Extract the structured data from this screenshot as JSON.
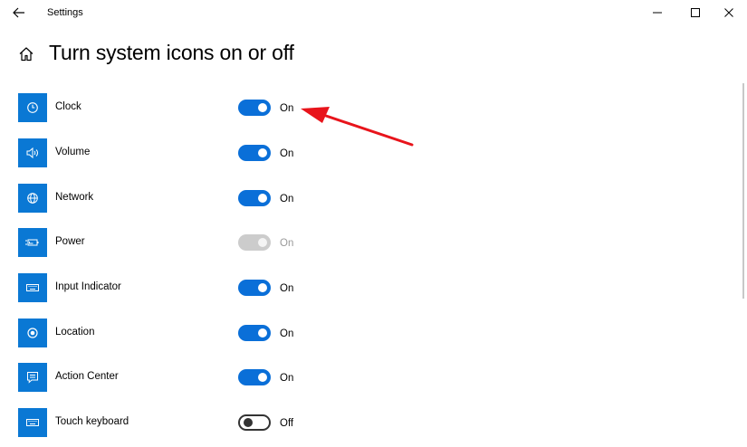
{
  "window": {
    "title": "Settings",
    "icons": {
      "back": "back-arrow-icon",
      "minimize": "minimize-icon",
      "maximize": "maximize-icon",
      "close": "close-icon"
    }
  },
  "page": {
    "title": "Turn system icons on or off",
    "home_icon": "home-icon"
  },
  "items": [
    {
      "label": "Clock",
      "icon": "clock-icon",
      "state": "On",
      "enabled": true,
      "on": true
    },
    {
      "label": "Volume",
      "icon": "volume-icon",
      "state": "On",
      "enabled": true,
      "on": true
    },
    {
      "label": "Network",
      "icon": "network-icon",
      "state": "On",
      "enabled": true,
      "on": true
    },
    {
      "label": "Power",
      "icon": "power-icon",
      "state": "On",
      "enabled": false,
      "on": true
    },
    {
      "label": "Input Indicator",
      "icon": "keyboard-icon",
      "state": "On",
      "enabled": true,
      "on": true
    },
    {
      "label": "Location",
      "icon": "location-icon",
      "state": "On",
      "enabled": true,
      "on": true
    },
    {
      "label": "Action Center",
      "icon": "action-center-icon",
      "state": "On",
      "enabled": true,
      "on": true
    },
    {
      "label": "Touch keyboard",
      "icon": "touch-keyboard-icon",
      "state": "Off",
      "enabled": true,
      "on": false
    }
  ],
  "annotation": {
    "icon": "red-arrow-annotation-icon",
    "color": "#e8141b"
  },
  "colors": {
    "accent": "#0a78d4",
    "toggle_on": "#0a6fd8",
    "disabled": "#cccccc"
  }
}
